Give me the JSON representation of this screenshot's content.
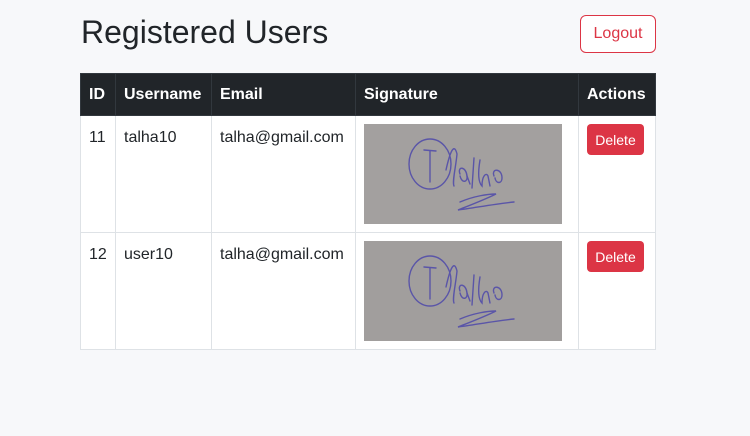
{
  "page": {
    "title": "Registered Users",
    "logout_label": "Logout"
  },
  "table": {
    "headers": [
      "ID",
      "Username",
      "Email",
      "Signature",
      "Actions"
    ],
    "rows": [
      {
        "id": "11",
        "username": "talha10",
        "email": "talha@gmail.com",
        "signature": "Talha",
        "action_label": "Delete"
      },
      {
        "id": "12",
        "username": "user10",
        "email": "talha@gmail.com",
        "signature": "Talha",
        "action_label": "Delete"
      }
    ]
  },
  "colors": {
    "danger": "#dc3545",
    "header_bg": "#212529",
    "page_bg": "#f7f8fa"
  },
  "icons": []
}
